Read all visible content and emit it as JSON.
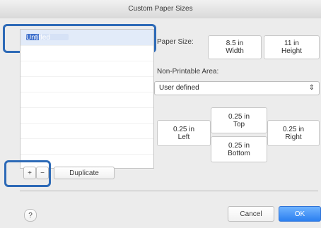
{
  "window": {
    "title": "Custom Paper Sizes"
  },
  "list": {
    "items": [
      "Untitled"
    ],
    "selected_index": 0
  },
  "controls": {
    "paper_size_label": "Paper Size:",
    "width_value": "8.5 in",
    "width_caption": "Width",
    "height_value": "11 in",
    "height_caption": "Height",
    "margins_label": "Non-Printable Area:",
    "margins_select": "User defined",
    "top_value": "0.25 in",
    "top_caption": "Top",
    "left_value": "0.25 in",
    "left_caption": "Left",
    "right_value": "0.25 in",
    "right_caption": "Right",
    "bottom_value": "0.25 in",
    "bottom_caption": "Bottom"
  },
  "bottom_bar": {
    "add_label": "+",
    "remove_label": "−",
    "duplicate_label": "Duplicate",
    "help_label": "?",
    "cancel_label": "Cancel",
    "ok_label": "OK"
  }
}
